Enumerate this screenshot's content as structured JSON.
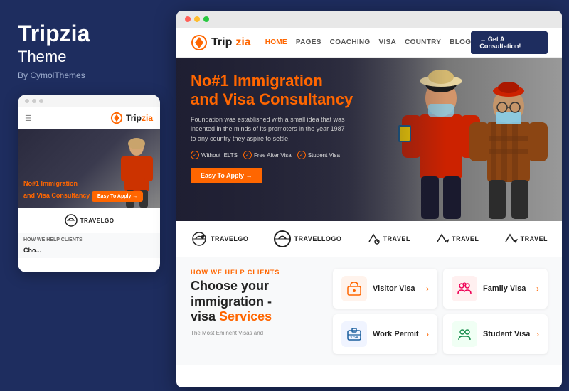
{
  "sidebar": {
    "title": "Tripzia",
    "subtitle": "Theme",
    "by": "By CymolThemes"
  },
  "mobile": {
    "nav_logo": "Tripzia",
    "hero_title_line1": "No#1 Immigration",
    "hero_title_line2": "and Visa Consultancy",
    "hero_btn": "Easy To Apply →",
    "logo_text": "TRAVELGO",
    "bottom_label": "HOW WE HELP CLIENTS",
    "bottom_choose": "Cho..."
  },
  "browser": {
    "nav": {
      "logo_part1": "Trip",
      "logo_part2": "zia",
      "links": [
        "HOME",
        "PAGES",
        "COACHING",
        "VISA",
        "COUNTRY",
        "BLOG"
      ],
      "cta": "→ Get A Consultation!"
    },
    "hero": {
      "title_orange": "No#1 Immigration",
      "title_white": "and Visa Consultancy",
      "description": "Foundation was established with a small idea that was incented in the minds of its promoters in the year 1987 to any country they aspire to settle.",
      "badges": [
        "Without IELTS",
        "Free After Visa",
        "Student Visa"
      ],
      "cta_btn": "Easy To Apply →"
    },
    "logos": [
      "TRAVELGO",
      "Travellogo",
      "travel",
      "Travel",
      "travel"
    ],
    "services": {
      "how_label": "HOW WE HELP CLIENTS",
      "title_line1": "Choose your",
      "title_line2": "immigration -",
      "title_line3": "visa",
      "title_orange": "Services",
      "description": "The Most Eminent Visas and",
      "cards": [
        {
          "name": "Visitor Visa",
          "icon": "🏛️",
          "icon_bg": "orange-bg"
        },
        {
          "name": "Family Visa",
          "icon": "👨‍👩‍👧",
          "icon_bg": "red-bg"
        },
        {
          "name": "Work Permit",
          "icon": "💼",
          "icon_bg": "blue-bg"
        },
        {
          "name": "Student Visa",
          "icon": "👥",
          "icon_bg": "green-bg"
        }
      ]
    }
  }
}
